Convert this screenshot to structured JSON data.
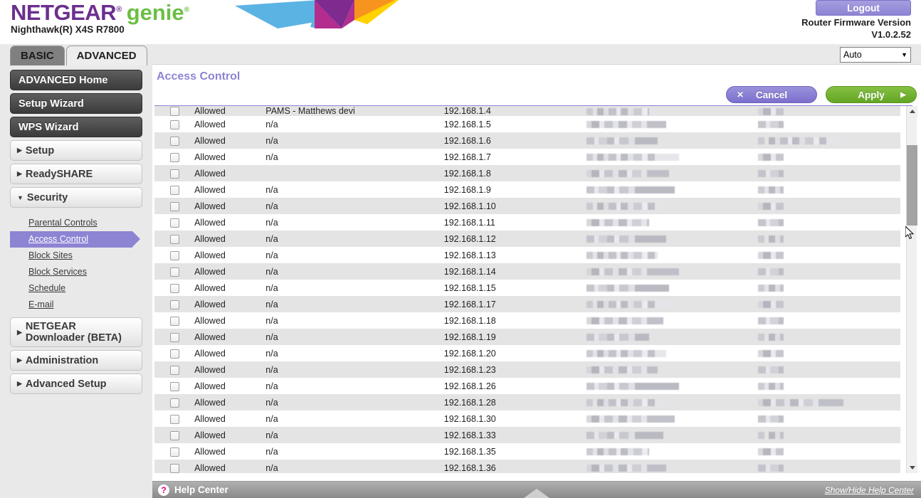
{
  "header": {
    "logo_netgear": "NETGEAR",
    "logo_reg": "®",
    "logo_genie": "genie",
    "logo_reg2": "®",
    "model": "Nighthawk(R) X4S R7800",
    "logout_label": "Logout",
    "firmware_label": "Router Firmware Version",
    "firmware_version": "V1.0.2.52",
    "brand_color": "#6b2f8e",
    "genie_color": "#6cbe45",
    "accent_color": "#8d84d4"
  },
  "tabs": [
    {
      "label": "BASIC",
      "active": false
    },
    {
      "label": "ADVANCED",
      "active": true
    }
  ],
  "language_select": {
    "value": "Auto",
    "arrow": "▼"
  },
  "sidebar": {
    "buttons": [
      {
        "label": "ADVANCED Home",
        "style": "dark"
      },
      {
        "label": "Setup Wizard",
        "style": "dark"
      },
      {
        "label": "WPS Wizard",
        "style": "dark"
      }
    ],
    "groups": [
      {
        "label": "Setup",
        "expanded": false,
        "marker": "▶"
      },
      {
        "label": "ReadySHARE",
        "expanded": false,
        "marker": "▶"
      },
      {
        "label": "Security",
        "expanded": true,
        "marker": "▼"
      }
    ],
    "security_items": [
      {
        "label": "Parental Controls",
        "active": false
      },
      {
        "label": "Access Control",
        "active": true
      },
      {
        "label": "Block Sites",
        "active": false
      },
      {
        "label": "Block Services",
        "active": false
      },
      {
        "label": "Schedule",
        "active": false
      },
      {
        "label": "E-mail",
        "active": false
      }
    ],
    "groups_bottom": [
      {
        "label": "NETGEAR Downloader (BETA)",
        "marker": "▶"
      },
      {
        "label": "Administration",
        "marker": "▶"
      },
      {
        "label": "Advanced Setup",
        "marker": "▶"
      }
    ]
  },
  "main": {
    "title": "Access Control",
    "cancel_label": "Cancel",
    "cancel_glyph": "✕",
    "apply_label": "Apply",
    "apply_glyph": "▶"
  },
  "table": {
    "rows": [
      {
        "status": "Allowed",
        "name": "PAMS - Matthews devi",
        "ip": "192.168.1.4",
        "mac": "redacted",
        "type": "redacted",
        "clipped": true
      },
      {
        "status": "Allowed",
        "name": "n/a",
        "ip": "192.168.1.5",
        "mac": "redacted",
        "type": "redacted"
      },
      {
        "status": "Allowed",
        "name": "n/a",
        "ip": "192.168.1.6",
        "mac": "redacted",
        "type": "redacted"
      },
      {
        "status": "Allowed",
        "name": "n/a",
        "ip": "192.168.1.7",
        "mac": "redacted",
        "type": "redacted"
      },
      {
        "status": "Allowed",
        "name": "",
        "ip": "192.168.1.8",
        "mac": "redacted",
        "type": "redacted"
      },
      {
        "status": "Allowed",
        "name": "n/a",
        "ip": "192.168.1.9",
        "mac": "redacted",
        "type": "redacted"
      },
      {
        "status": "Allowed",
        "name": "n/a",
        "ip": "192.168.1.10",
        "mac": "redacted",
        "type": "redacted"
      },
      {
        "status": "Allowed",
        "name": "n/a",
        "ip": "192.168.1.11",
        "mac": "redacted",
        "type": "redacted"
      },
      {
        "status": "Allowed",
        "name": "n/a",
        "ip": "192.168.1.12",
        "mac": "redacted",
        "type": "redacted"
      },
      {
        "status": "Allowed",
        "name": "n/a",
        "ip": "192.168.1.13",
        "mac": "redacted",
        "type": "redacted"
      },
      {
        "status": "Allowed",
        "name": "n/a",
        "ip": "192.168.1.14",
        "mac": "redacted",
        "type": "redacted"
      },
      {
        "status": "Allowed",
        "name": "n/a",
        "ip": "192.168.1.15",
        "mac": "redacted",
        "type": "redacted"
      },
      {
        "status": "Allowed",
        "name": "n/a",
        "ip": "192.168.1.17",
        "mac": "redacted",
        "type": "redacted"
      },
      {
        "status": "Allowed",
        "name": "n/a",
        "ip": "192.168.1.18",
        "mac": "redacted",
        "type": "redacted"
      },
      {
        "status": "Allowed",
        "name": "n/a",
        "ip": "192.168.1.19",
        "mac": "redacted",
        "type": "redacted"
      },
      {
        "status": "Allowed",
        "name": "n/a",
        "ip": "192.168.1.20",
        "mac": "redacted",
        "type": "redacted"
      },
      {
        "status": "Allowed",
        "name": "n/a",
        "ip": "192.168.1.23",
        "mac": "redacted",
        "type": "redacted"
      },
      {
        "status": "Allowed",
        "name": "n/a",
        "ip": "192.168.1.26",
        "mac": "redacted",
        "type": "redacted"
      },
      {
        "status": "Allowed",
        "name": "n/a",
        "ip": "192.168.1.28",
        "mac": "redacted",
        "type": "redacted"
      },
      {
        "status": "Allowed",
        "name": "n/a",
        "ip": "192.168.1.30",
        "mac": "redacted",
        "type": "redacted"
      },
      {
        "status": "Allowed",
        "name": "n/a",
        "ip": "192.168.1.33",
        "mac": "redacted",
        "type": "redacted"
      },
      {
        "status": "Allowed",
        "name": "n/a",
        "ip": "192.168.1.35",
        "mac": "redacted",
        "type": "redacted"
      },
      {
        "status": "Allowed",
        "name": "n/a",
        "ip": "192.168.1.36",
        "mac": "redacted",
        "type": "redacted"
      }
    ]
  },
  "scrollbar": {
    "up_arrow": "▲",
    "down_arrow": "▼"
  },
  "footer": {
    "help_glyph": "?",
    "help_label": "Help Center",
    "show_hide_label": "Show/Hide Help Center"
  }
}
